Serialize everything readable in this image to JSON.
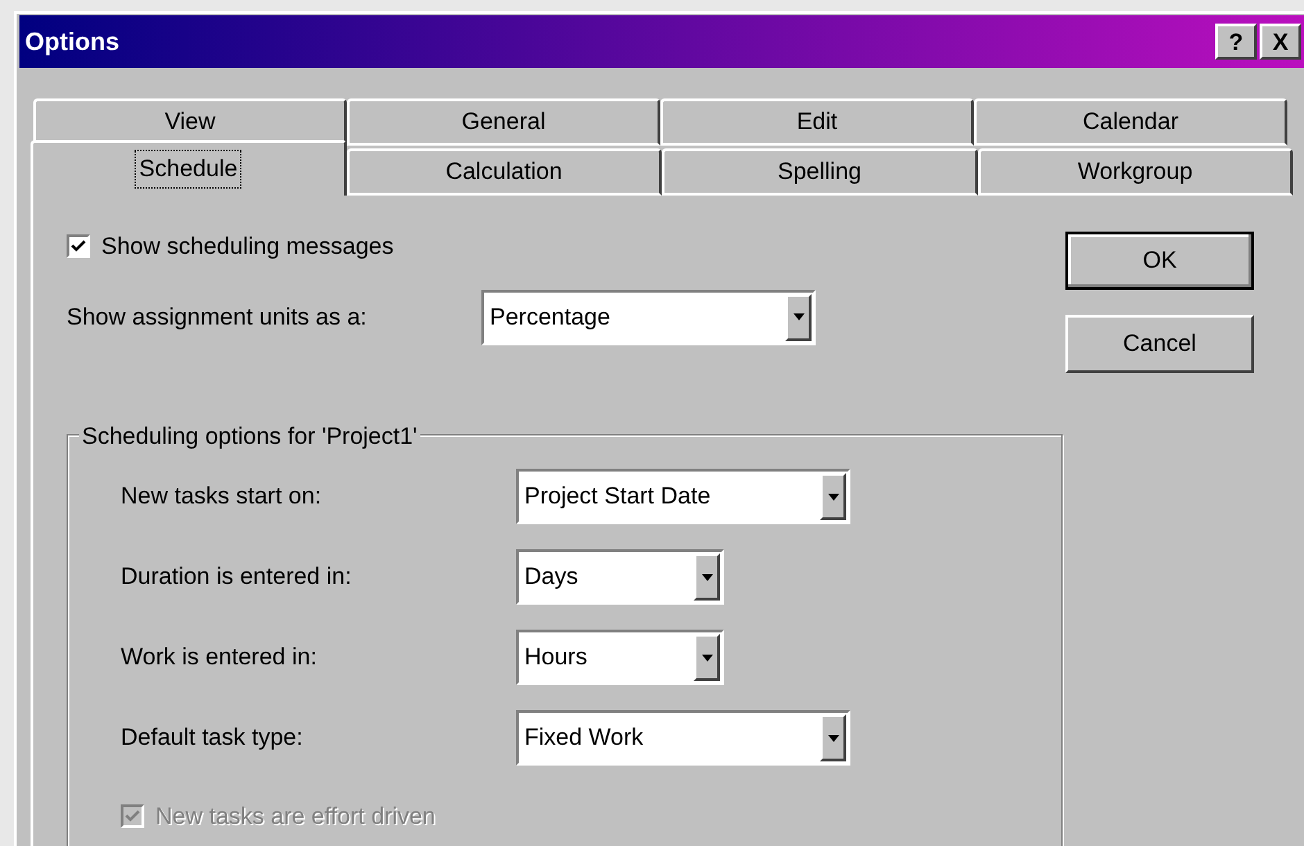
{
  "window": {
    "title": "Options",
    "buttons": [
      "?",
      "X"
    ]
  },
  "tab_rows": [
    [
      {
        "label": "View",
        "selected": false
      },
      {
        "label": "General",
        "selected": false
      },
      {
        "label": "Edit",
        "selected": false
      },
      {
        "label": "Calendar",
        "selected": false
      }
    ],
    [
      {
        "label": "Schedule",
        "selected": true
      },
      {
        "label": "Calculation",
        "selected": false
      },
      {
        "label": "Spelling",
        "selected": false
      },
      {
        "label": "Workgroup",
        "selected": false
      }
    ]
  ],
  "show_scheduling_messages": {
    "label": "Show scheduling messages",
    "checked": true,
    "disabled": false
  },
  "assignment_units": {
    "label": "Show assignment units as a:",
    "value": "Percentage"
  },
  "buttons": [
    {
      "label": "OK",
      "default": true
    },
    {
      "label": "Cancel",
      "default": false
    }
  ],
  "group": {
    "title": "Scheduling options for 'Project1'",
    "fields": [
      {
        "label": "New tasks start on:",
        "value": "Project Start Date",
        "kind": "wide"
      },
      {
        "label": "Duration is entered in:",
        "value": "Days",
        "kind": "narrow"
      },
      {
        "label": "Work is entered in:",
        "value": "Hours",
        "kind": "narrow"
      },
      {
        "label": "Default task type:",
        "value": "Fixed Work",
        "kind": "wide"
      }
    ],
    "effort_driven": {
      "label": "New tasks are effort driven",
      "checked": true,
      "disabled": true
    }
  }
}
